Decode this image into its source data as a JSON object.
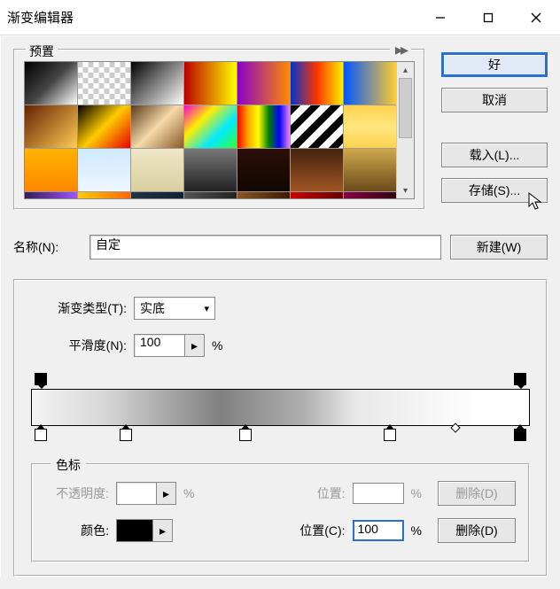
{
  "window": {
    "title": "渐变编辑器"
  },
  "presets": {
    "legend": "预置"
  },
  "buttons": {
    "ok": "好",
    "cancel": "取消",
    "load": "载入(L)...",
    "save": "存储(S)...",
    "new": "新建(W)"
  },
  "fields": {
    "name_label": "名称(N):",
    "name_value": "自定",
    "gradient_type_label": "渐变类型(T):",
    "gradient_type_value": "实底",
    "smoothness_label": "平滑度(N):",
    "smoothness_value": "100",
    "percent": "%"
  },
  "stops": {
    "legend": "色标",
    "opacity_label": "不透明度:",
    "opacity_value": "",
    "location_label": "位置:",
    "location_value": "",
    "delete_top": "删除(D)",
    "color_label": "颜色:",
    "location2_label": "位置(C):",
    "location2_value": "100",
    "delete_bottom": "删除(D)"
  },
  "swatches": {
    "css": [
      "linear-gradient(135deg,#000 0%,#444 50%,#fff 100%)",
      "repeating-conic-gradient(#ccc 0 25%,#fff 0 50%) 50%/12px 12px,linear-gradient(135deg,#000,transparent)",
      "linear-gradient(135deg,#000,#fff)",
      "linear-gradient(90deg,#b00,#ff0)",
      "linear-gradient(90deg,#8a00c9,#ff8a00)",
      "linear-gradient(90deg,#0033cc,#ff3300,#ffee00)",
      "linear-gradient(90deg,#0055ff,#ffcc33)",
      "linear-gradient(135deg,#662200,#ffcc55)",
      "linear-gradient(135deg,#000,#ffcc00,#e60000)",
      "linear-gradient(135deg,#5a3a1a,#f5d9a8,#8a5a2a)",
      "linear-gradient(135deg,#ff00cc,#ffee00,#00eaff,#33ff33)",
      "linear-gradient(90deg,red,orange,yellow,green,blue,violet)",
      "repeating-linear-gradient(135deg,#000 0 8px,#fff 8px 16px)",
      "linear-gradient(180deg,#ffd24d,#ffe680,#ffd24d)",
      "linear-gradient(180deg,#ffb300,#ff8800)",
      "linear-gradient(180deg,#cfe8ff,#eef6ff)",
      "linear-gradient(180deg,#eee7c8,#d9cfa0)",
      "linear-gradient(180deg,#777,#222)",
      "linear-gradient(180deg,#2b0f07,#120603)",
      "linear-gradient(180deg,#442210,#a05522)",
      "linear-gradient(180deg,#cfa84d,#6a4a1a)",
      "linear-gradient(90deg,#3a1a55,#9a55ff)",
      "linear-gradient(90deg,#ffcc00,#ff6600)",
      "linear-gradient(90deg,#223344,#112233)",
      "linear-gradient(90deg,#555,#222)",
      "linear-gradient(90deg,#8a5522,#3a1a00)",
      "linear-gradient(90deg,#cc0000,#660000)",
      "linear-gradient(90deg,#880044,#330011)"
    ]
  }
}
